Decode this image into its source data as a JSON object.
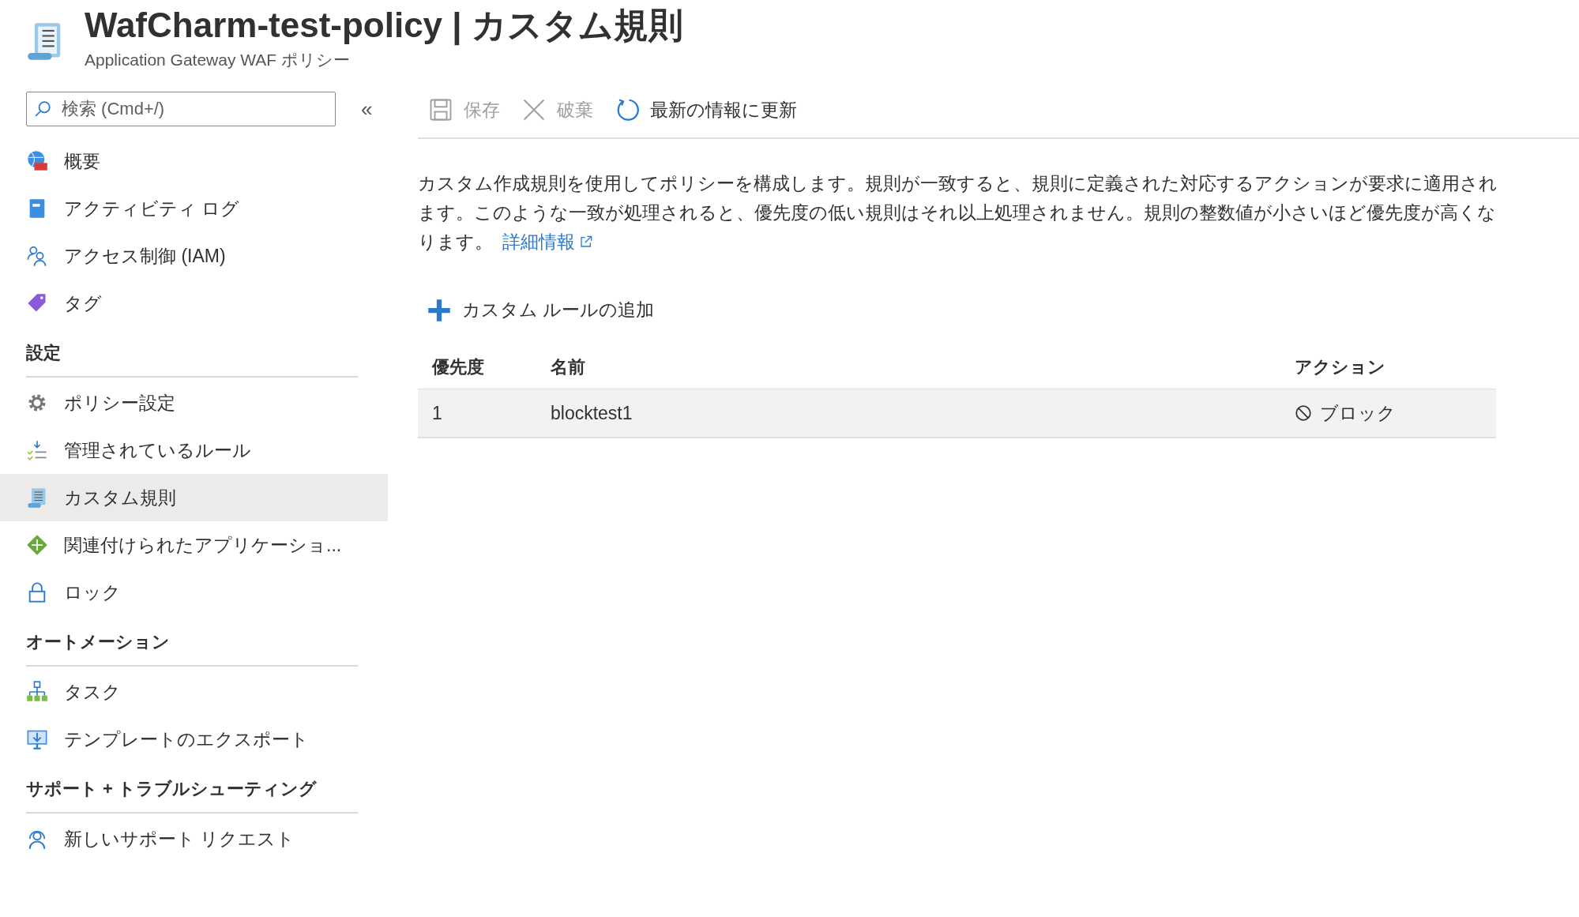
{
  "header": {
    "title": "WafCharm-test-policy | カスタム規則",
    "subtitle": "Application Gateway WAF ポリシー"
  },
  "search": {
    "placeholder": "検索 (Cmd+/)",
    "collapse": "«"
  },
  "sidebar": {
    "sections": [
      {
        "items": [
          {
            "label": "概要",
            "selected": false
          },
          {
            "label": "アクティビティ ログ",
            "selected": false
          },
          {
            "label": "アクセス制御 (IAM)",
            "selected": false
          },
          {
            "label": "タグ",
            "selected": false
          }
        ]
      },
      {
        "heading": "設定",
        "items": [
          {
            "label": "ポリシー設定",
            "selected": false
          },
          {
            "label": "管理されているルール",
            "selected": false
          },
          {
            "label": "カスタム規則",
            "selected": true
          },
          {
            "label": "関連付けられたアプリケーショ...",
            "selected": false
          },
          {
            "label": "ロック",
            "selected": false
          }
        ]
      },
      {
        "heading": "オートメーション",
        "items": [
          {
            "label": "タスク",
            "selected": false
          },
          {
            "label": "テンプレートのエクスポート",
            "selected": false
          }
        ]
      },
      {
        "heading": "サポート + トラブルシューティング",
        "items": [
          {
            "label": "新しいサポート リクエスト",
            "selected": false
          }
        ]
      }
    ]
  },
  "toolbar": [
    {
      "label": "保存",
      "disabled": true
    },
    {
      "label": "破棄",
      "disabled": true
    },
    {
      "label": "最新の情報に更新",
      "disabled": false
    }
  ],
  "description": {
    "text": "カスタム作成規則を使用してポリシーを構成します。規則が一致すると、規則に定義された対応するアクションが要求に適用されます。このような一致が処理されると、優先度の低い規則はそれ以上処理されません。規則の整数値が小さいほど優先度が高くなります。",
    "link": "詳細情報"
  },
  "add_button": "カスタム ルールの追加",
  "table": {
    "columns": [
      "優先度",
      "名前",
      "アクション"
    ],
    "rows": [
      {
        "priority": "1",
        "name": "blocktest1",
        "action": "ブロック",
        "selected": true
      }
    ]
  }
}
